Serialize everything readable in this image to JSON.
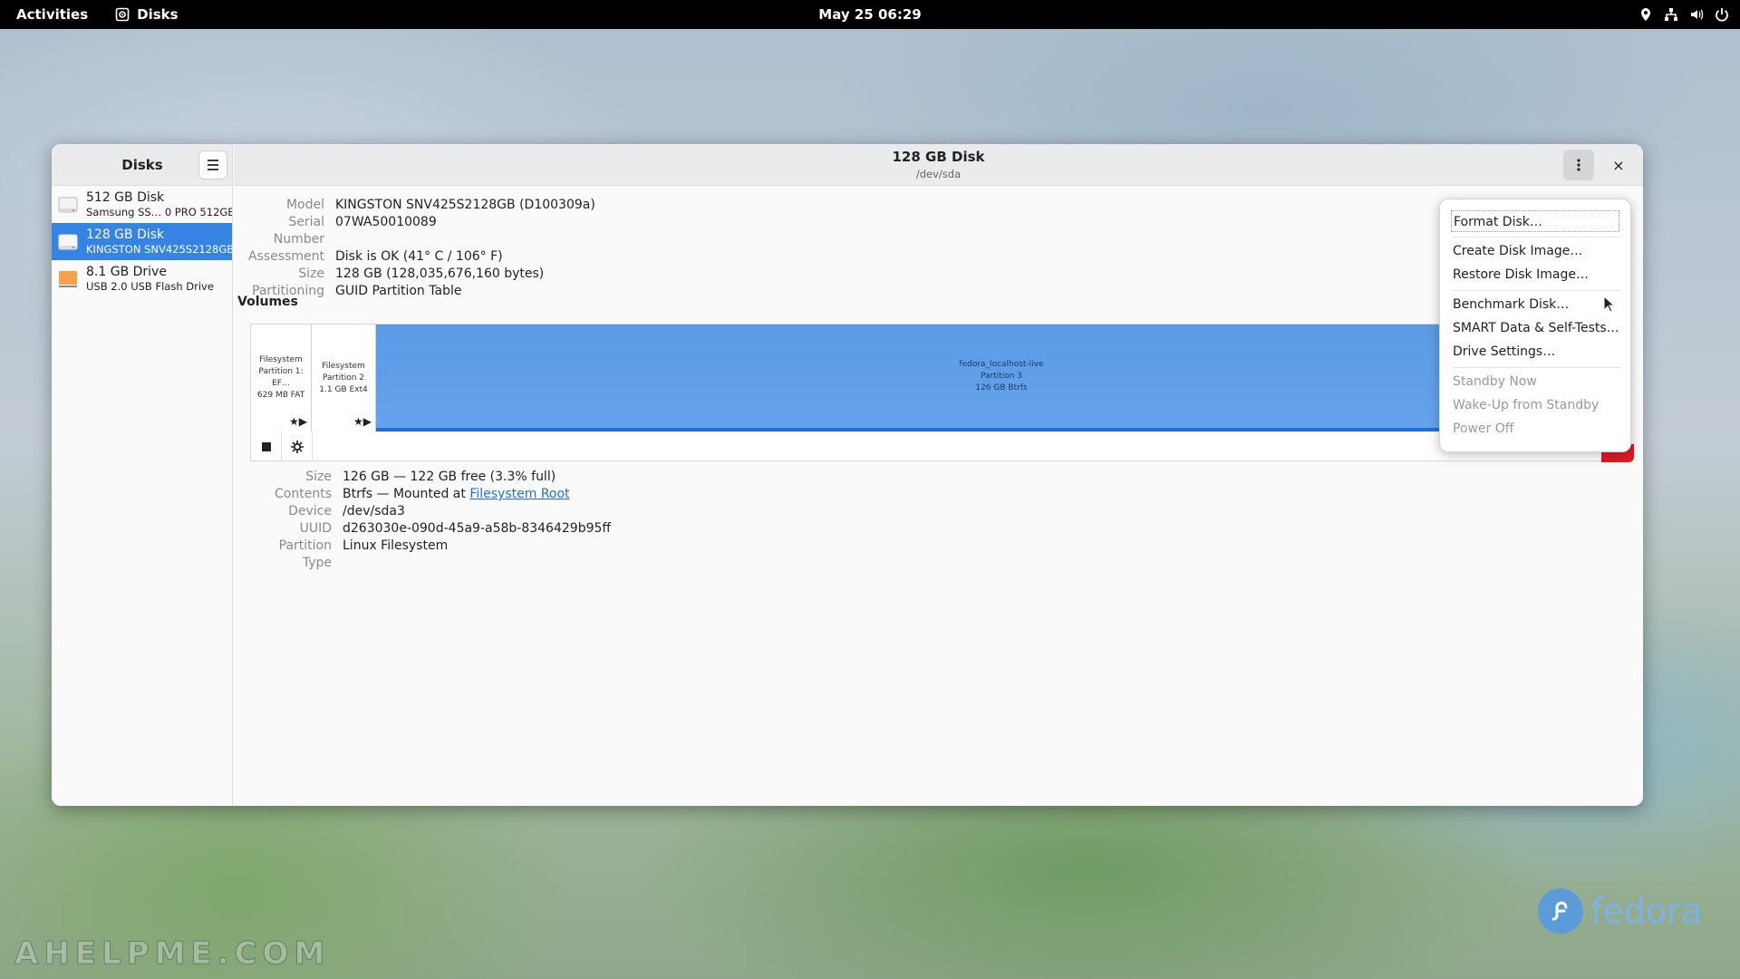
{
  "topbar": {
    "activities": "Activities",
    "app_name": "Disks",
    "clock": "May 25  06:29",
    "status_icons": [
      "location-icon",
      "network-icon",
      "volume-icon",
      "power-icon"
    ]
  },
  "sidebar": {
    "title": "Disks",
    "disks": [
      {
        "name": "512 GB Disk",
        "sub": "Samsung SS…  0 PRO 512GB",
        "icon": "hdd-icon"
      },
      {
        "name": "128 GB Disk",
        "sub": "KINGSTON SNV425S2128GB",
        "icon": "hdd-icon"
      },
      {
        "name": "8.1 GB Drive",
        "sub": "USB 2.0 USB Flash Drive",
        "icon": "usb-drive-icon"
      }
    ]
  },
  "main": {
    "title": "128 GB Disk",
    "subtitle": "/dev/sda",
    "close_label": "×",
    "disk_info": [
      {
        "key": "Model",
        "value": "KINGSTON SNV425S2128GB (D100309a)"
      },
      {
        "key": "Serial Number",
        "value": "07WA50010089"
      },
      {
        "key": "Assessment",
        "value": "Disk is OK (41° C / 106° F)"
      },
      {
        "key": "Size",
        "value": "128 GB (128,035,676,160 bytes)"
      },
      {
        "key": "Partitioning",
        "value": "GUID Partition Table"
      }
    ],
    "volumes_label": "Volumes",
    "partitions": [
      {
        "line1": "Filesystem",
        "line2": "Partition 1: EF…",
        "line3": "629 MB FAT",
        "icons": "★▶"
      },
      {
        "line1": "Filesystem",
        "line2": "Partition 2",
        "line3": "1.1 GB Ext4",
        "icons": "★▶"
      },
      {
        "line1": "fedora_localhost-live",
        "line2": "Partition 3",
        "line3": "126 GB Btrfs",
        "icons": ""
      }
    ],
    "volume_info": {
      "size_key": "Size",
      "size_value": "126 GB — 122 GB free (3.3% full)",
      "contents_key": "Contents",
      "contents_prefix": "Btrfs — Mounted at ",
      "contents_link": "Filesystem Root",
      "device_key": "Device",
      "device_value": "/dev/sda3",
      "uuid_key": "UUID",
      "uuid_value": "d263030e-090d-45a9-a58b-8346429b95ff",
      "parttype_key": "Partition Type",
      "parttype_value": "Linux Filesystem"
    }
  },
  "menu": {
    "items": [
      {
        "label": "Format Disk…",
        "enabled": true
      },
      {
        "label": "Create Disk Image…",
        "enabled": true
      },
      {
        "label": "Restore Disk Image…",
        "enabled": true
      },
      {
        "label": "Benchmark Disk…",
        "enabled": true
      },
      {
        "label": "SMART Data & Self-Tests…",
        "enabled": true
      },
      {
        "label": "Drive Settings…",
        "enabled": true
      },
      {
        "label": "Standby Now",
        "enabled": false
      },
      {
        "label": "Wake-Up from Standby",
        "enabled": false
      },
      {
        "label": "Power Off",
        "enabled": false
      }
    ]
  },
  "desktop": {
    "brand": "fedora",
    "watermark": "AHELPME.COM"
  },
  "colors": {
    "accent": "#3584e4",
    "danger": "#e01b24"
  }
}
